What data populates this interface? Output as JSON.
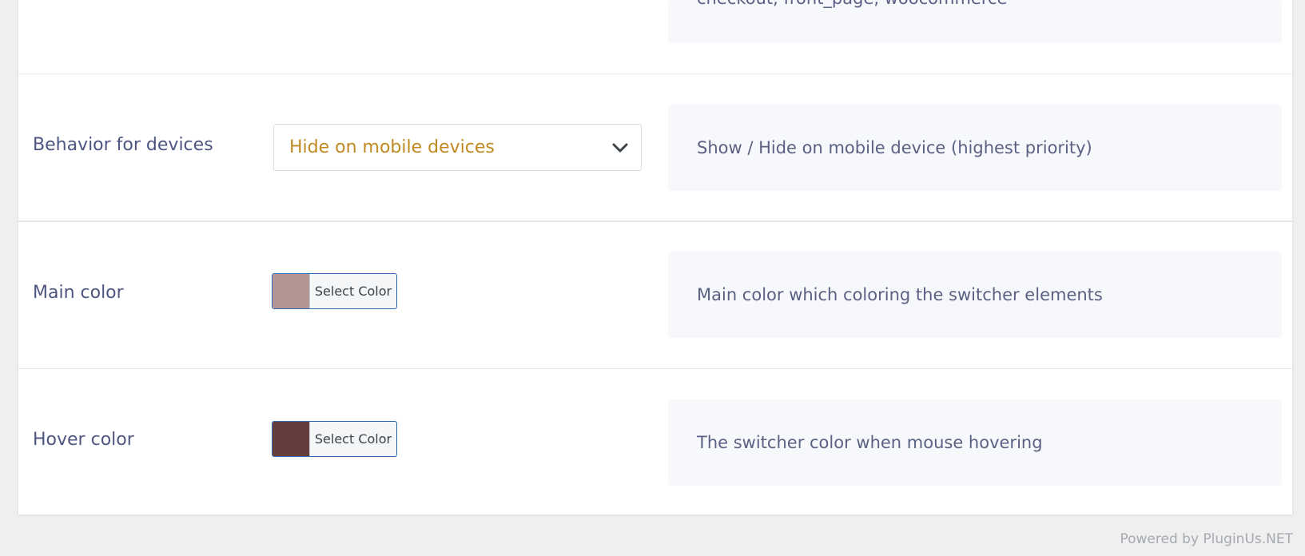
{
  "rows": {
    "top_partial": {
      "description": "checkout, front_page, woocommerce"
    },
    "devices": {
      "label": "Behavior for devices",
      "selected_value": "Hide on mobile devices",
      "description": "Show / Hide on mobile device (highest priority)"
    },
    "main_color": {
      "label": "Main color",
      "button_label": "Select Color",
      "swatch_color": "#b39594",
      "description": "Main color which coloring the switcher elements"
    },
    "hover_color": {
      "label": "Hover color",
      "button_label": "Select Color",
      "swatch_color": "#663d3d",
      "description": "The switcher color when mouse hovering"
    }
  },
  "footer": {
    "text": "Powered by PluginUs.NET"
  },
  "colors": {
    "accent_select_text": "#c08a23",
    "label_text": "#4d5680",
    "color_button_border": "#2f6bb3"
  }
}
